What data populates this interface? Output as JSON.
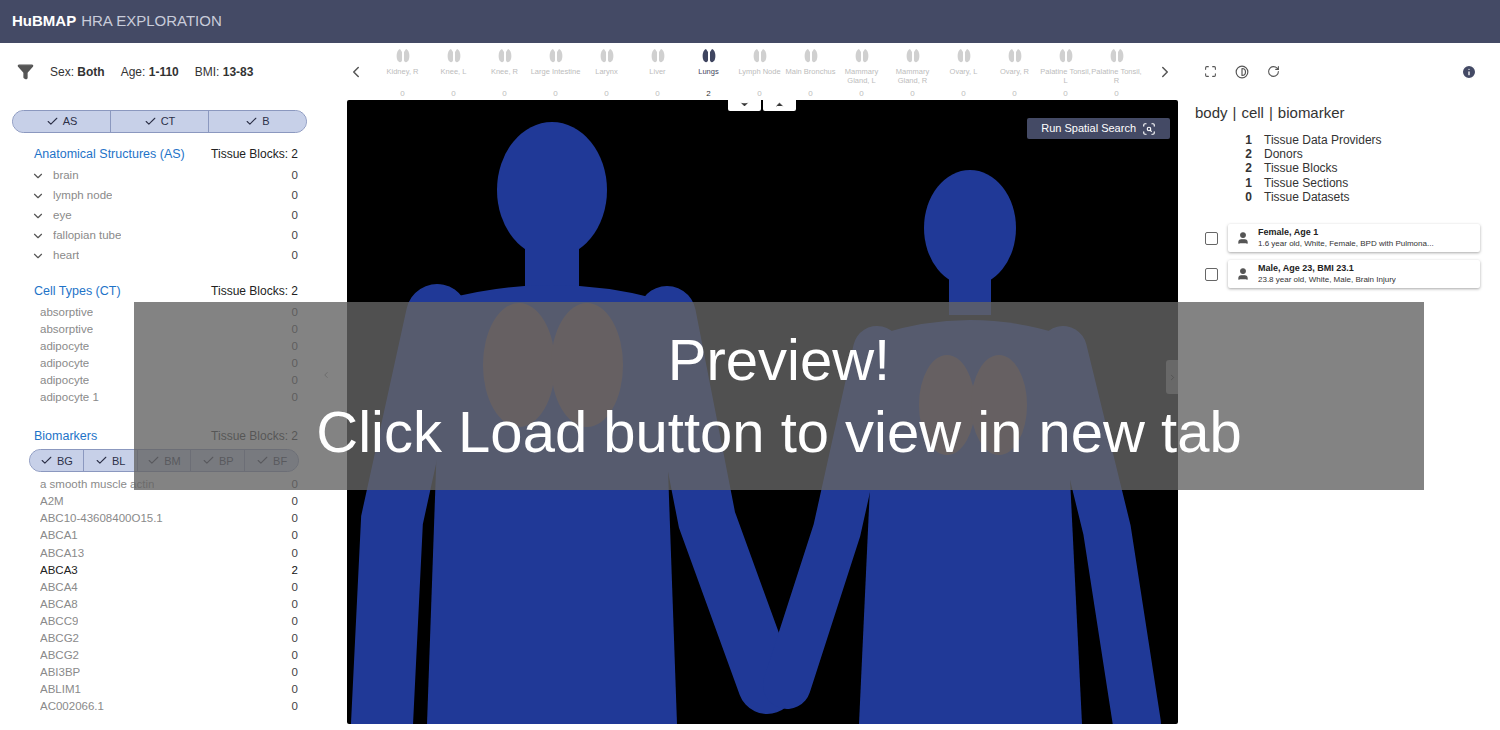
{
  "header": {
    "brand": "HuBMAP",
    "title": "HRA EXPLORATION"
  },
  "filters": [
    {
      "label": "Sex:",
      "value": "Both"
    },
    {
      "label": "Age:",
      "value": "1-110"
    },
    {
      "label": "BMI:",
      "value": "13-83"
    }
  ],
  "organs": [
    {
      "label": "Kidney, R",
      "count": "0",
      "selected": false
    },
    {
      "label": "Knee, L",
      "count": "0",
      "selected": false
    },
    {
      "label": "Knee, R",
      "count": "0",
      "selected": false
    },
    {
      "label": "Large Intestine",
      "count": "0",
      "selected": false
    },
    {
      "label": "Larynx",
      "count": "0",
      "selected": false
    },
    {
      "label": "Liver",
      "count": "0",
      "selected": false
    },
    {
      "label": "Lungs",
      "count": "2",
      "selected": true
    },
    {
      "label": "Lymph Node",
      "count": "0",
      "selected": false
    },
    {
      "label": "Main Bronchus",
      "count": "0",
      "selected": false
    },
    {
      "label": "Mammary Gland, L",
      "count": "0",
      "selected": false
    },
    {
      "label": "Mammary Gland, R",
      "count": "0",
      "selected": false
    },
    {
      "label": "Ovary, L",
      "count": "0",
      "selected": false
    },
    {
      "label": "Ovary, R",
      "count": "0",
      "selected": false
    },
    {
      "label": "Palatine Tonsil, L",
      "count": "0",
      "selected": false
    },
    {
      "label": "Palatine Tonsil, R",
      "count": "0",
      "selected": false
    }
  ],
  "layer_toggles": [
    {
      "label": "AS",
      "checked": true
    },
    {
      "label": "CT",
      "checked": true
    },
    {
      "label": "B",
      "checked": true
    }
  ],
  "anatomical_structures": {
    "title": "Anatomical Structures (AS)",
    "count_label": "Tissue Blocks: 2",
    "items": [
      {
        "label": "brain",
        "count": "0",
        "expanded": false,
        "active": false
      },
      {
        "label": "lymph node",
        "count": "0",
        "expanded": false,
        "active": false
      },
      {
        "label": "eye",
        "count": "0",
        "expanded": false,
        "active": false
      },
      {
        "label": "fallopian tube",
        "count": "0",
        "expanded": false,
        "active": false
      },
      {
        "label": "heart",
        "count": "0",
        "expanded": false,
        "active": false
      }
    ]
  },
  "cell_types": {
    "title": "Cell Types (CT)",
    "count_label": "Tissue Blocks: 2",
    "items": [
      {
        "label": "absorptive",
        "count": "0",
        "active": false
      },
      {
        "label": "absorptive",
        "count": "0",
        "active": false
      },
      {
        "label": "adipocyte",
        "count": "0",
        "active": false
      },
      {
        "label": "adipocyte",
        "count": "0",
        "active": false
      },
      {
        "label": "adipocyte",
        "count": "0",
        "active": false
      },
      {
        "label": "adipocyte 1",
        "count": "0",
        "active": false
      }
    ]
  },
  "biomarkers": {
    "title": "Biomarkers",
    "count_label": "Tissue Blocks: 2",
    "toggles": [
      {
        "label": "BG",
        "checked": true
      },
      {
        "label": "BL",
        "checked": true
      },
      {
        "label": "BM",
        "checked": true
      },
      {
        "label": "BP",
        "checked": true
      },
      {
        "label": "BF",
        "checked": true
      }
    ],
    "items": [
      {
        "label": "a smooth muscle actin",
        "count": "0",
        "active": false
      },
      {
        "label": "A2M",
        "count": "0",
        "active": false
      },
      {
        "label": "ABC10-43608400O15.1",
        "count": "0",
        "active": false
      },
      {
        "label": "ABCA1",
        "count": "0",
        "active": false
      },
      {
        "label": "ABCA13",
        "count": "0",
        "active": false
      },
      {
        "label": "ABCA3",
        "count": "2",
        "active": true
      },
      {
        "label": "ABCA4",
        "count": "0",
        "active": false
      },
      {
        "label": "ABCA8",
        "count": "0",
        "active": false
      },
      {
        "label": "ABCC9",
        "count": "0",
        "active": false
      },
      {
        "label": "ABCG2",
        "count": "0",
        "active": false
      },
      {
        "label": "ABCG2",
        "count": "0",
        "active": false
      },
      {
        "label": "ABI3BP",
        "count": "0",
        "active": false
      },
      {
        "label": "ABLIM1",
        "count": "0",
        "active": false
      },
      {
        "label": "AC002066.1",
        "count": "0",
        "active": false
      }
    ]
  },
  "viewport": {
    "spatial_search_button": "Run Spatial Search"
  },
  "summary": {
    "views": [
      "body",
      "cell",
      "biomarker"
    ],
    "separator": "|",
    "stats": [
      {
        "value": "1",
        "label": "Tissue Data Providers"
      },
      {
        "value": "2",
        "label": "Donors"
      },
      {
        "value": "2",
        "label": "Tissue Blocks"
      },
      {
        "value": "1",
        "label": "Tissue Sections"
      },
      {
        "value": "0",
        "label": "Tissue Datasets"
      }
    ]
  },
  "donors": [
    {
      "title": "Female, Age 1",
      "subtitle": "1.6 year old, White, Female, BPD with Pulmona...",
      "checked": false
    },
    {
      "title": "Male, Age 23, BMI 23.1",
      "subtitle": "23.8 year old, White, Male, Brain Injury",
      "checked": false
    }
  ],
  "overlay": {
    "lines": [
      "Preview!",
      "Click Load button to view in new tab"
    ]
  }
}
